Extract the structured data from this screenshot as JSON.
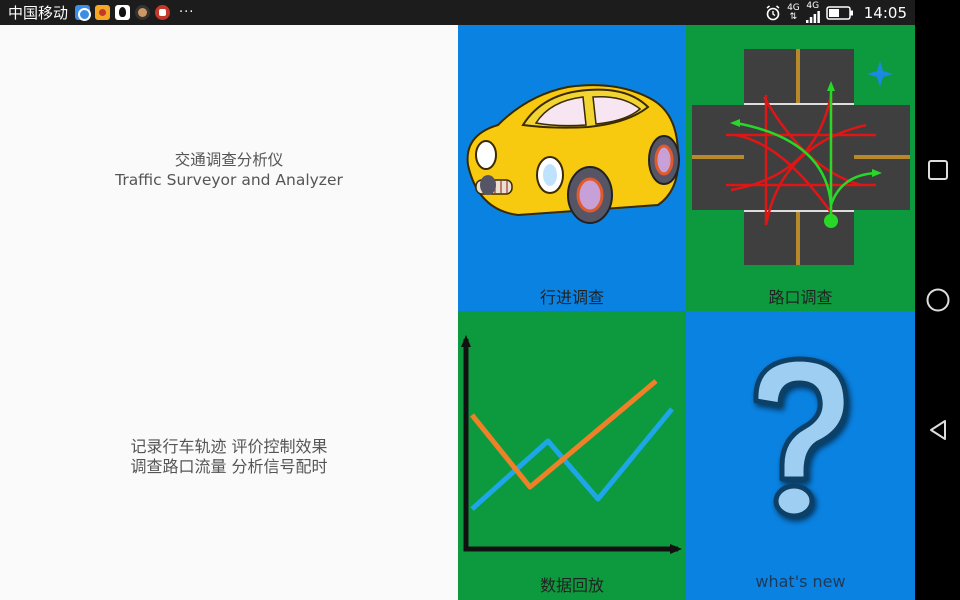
{
  "status_bar": {
    "carrier": "中国移动",
    "more": "···",
    "network_1": "4G",
    "network_2": "4G",
    "time": "14:05"
  },
  "intro": {
    "title_cn": "交通调查分析仪",
    "title_en": "Traffic Surveyor and Analyzer",
    "desc_line1": "记录行车轨迹 评价控制效果",
    "desc_line2": "调查路口流量 分析信号配时"
  },
  "tiles": {
    "travel": {
      "label": "行进调查",
      "icon": "car-icon"
    },
    "intersection": {
      "label": "路口调查",
      "icon": "intersection-icon"
    },
    "playback": {
      "label": "数据回放",
      "icon": "line-chart-icon"
    },
    "whats_new": {
      "label": "what's new",
      "icon": "question-mark-icon"
    }
  },
  "colors": {
    "blue_tile": "#0a82e2",
    "green_tile": "#0d9a3f",
    "left_bg": "#fafafa"
  }
}
